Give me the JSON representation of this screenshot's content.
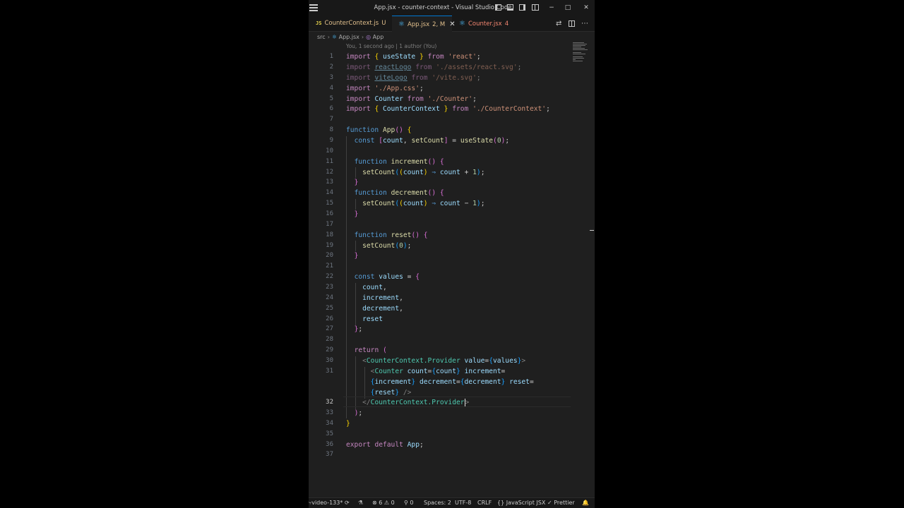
{
  "window": {
    "title": "App.jsx - counter-context - Visual Studio Code",
    "controls": {
      "minimize": "−",
      "maximize": "□",
      "close": "✕"
    }
  },
  "tabs": [
    {
      "label": "CounterContext.js",
      "badge": "U",
      "icon": "js-file-icon",
      "color": "#e2c08d"
    },
    {
      "label": "App.jsx",
      "badge": "2, M",
      "icon": "react-icon",
      "color": "#e2c08d",
      "active": true
    },
    {
      "label": "Counter.jsx",
      "badge": "4",
      "icon": "react-icon",
      "color": "#f48771"
    }
  ],
  "breadcrumb": {
    "folder": "src",
    "file": "App.jsx",
    "symbol": "App"
  },
  "blame": "You, 1 second ago | 1 author (You)",
  "lines": {
    "n1": "1",
    "n2": "2",
    "n3": "3",
    "n4": "4",
    "n5": "5",
    "n6": "6",
    "n7": "7",
    "n8": "8",
    "n9": "9",
    "n10": "10",
    "n11": "11",
    "n12": "12",
    "n13": "13",
    "n14": "14",
    "n15": "15",
    "n16": "16",
    "n17": "17",
    "n18": "18",
    "n19": "19",
    "n20": "20",
    "n21": "21",
    "n22": "22",
    "n23": "23",
    "n24": "24",
    "n25": "25",
    "n26": "26",
    "n27": "27",
    "n28": "28",
    "n29": "29",
    "n30": "30",
    "n31": "31",
    "n32": "32",
    "n33": "33",
    "n34": "34",
    "n35": "35",
    "n36": "36",
    "n37": "37"
  },
  "t": {
    "import": "import",
    "from": "from",
    "lb": "{",
    "rb": "}",
    "semi": ";",
    "l1_useState": " useState ",
    "l1_path": "'react'",
    "l2_name": "reactLogo",
    "l2_path": "'./assets/react.svg'",
    "l3_name": "viteLogo",
    "l3_path": "'/vite.svg'",
    "l4_path": "'./App.css'",
    "l5_name": "Counter",
    "l5_path": "'./Counter'",
    "l6_name": " CounterContext ",
    "l6_path": "'./CounterContext'",
    "function": "function",
    "App": "App",
    "parens": "()",
    "const": "const",
    "count": "count",
    "setCount": "setCount",
    "useState": "useState",
    "zero": "0",
    "one": "1",
    "increment": "increment",
    "decrement": "decrement",
    "reset": "reset",
    "arrow": "⇒",
    "plus": "+",
    "minus": "−",
    "values": "values",
    "comma": ",",
    "eq": "=",
    "return": "return",
    "lp": "(",
    "rp": ")",
    "lt": "<",
    "ltslash": "</",
    "gt": ">",
    "selfclose": "/>",
    "Provider": "CounterContext.Provider",
    "value_attr": "value",
    "count_attr": "count",
    "increment_attr": "increment",
    "decrement_attr": "decrement",
    "reset_attr": "reset",
    "export": "export",
    "default": "default"
  },
  "status": {
    "branch": "video-133*",
    "errors": "6",
    "warnings": "0",
    "ports": "0",
    "spaces": "Spaces: 2",
    "encoding": "UTF-8",
    "eol": "CRLF",
    "language": "JavaScript JSX",
    "formatter": "Prettier"
  },
  "colors": {
    "accent": "#0078d4",
    "editor_bg": "#1f1f1f",
    "chrome_bg": "#181818"
  }
}
